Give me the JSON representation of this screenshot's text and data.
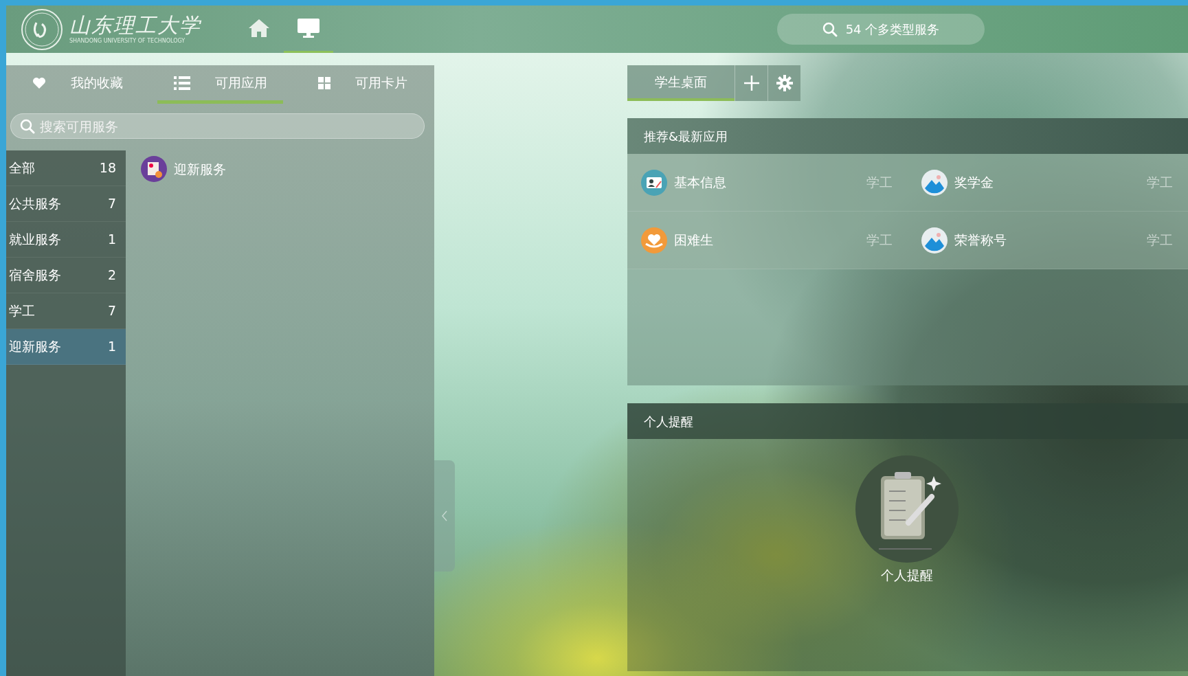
{
  "header": {
    "logo_title": "山东理工大学",
    "logo_subtitle": "SHANDONG UNIVERSITY OF TECHNOLOGY",
    "nav": [
      {
        "kind": "home",
        "selected": false
      },
      {
        "kind": "desktop",
        "selected": true
      }
    ],
    "search": {
      "label": "54 个多类型服务"
    }
  },
  "left_panel": {
    "tabs": [
      {
        "kind": "heart",
        "label": "我的收藏",
        "selected": false
      },
      {
        "kind": "list",
        "label": "可用应用",
        "selected": true
      },
      {
        "kind": "grid",
        "label": "可用卡片",
        "selected": false
      }
    ],
    "search": {
      "placeholder": "搜索可用服务"
    },
    "categories": [
      {
        "label": "全部",
        "count": "18",
        "selected": false
      },
      {
        "label": "公共服务",
        "count": "7",
        "selected": false
      },
      {
        "label": "就业服务",
        "count": "1",
        "selected": false
      },
      {
        "label": "宿舍服务",
        "count": "2",
        "selected": false
      },
      {
        "label": "学工",
        "count": "7",
        "selected": false
      },
      {
        "label": "迎新服务",
        "count": "1",
        "selected": true
      }
    ],
    "apps": [
      {
        "label": "迎新服务"
      }
    ]
  },
  "desktop_tabs": [
    {
      "label": "学生桌面",
      "selected": true
    }
  ],
  "recommended": {
    "title": "推荐&最新应用",
    "apps": [
      {
        "name": "基本信息",
        "tag": "学工",
        "kind": "profile"
      },
      {
        "name": "奖学金",
        "tag": "学工",
        "kind": "image"
      },
      {
        "name": "困难生",
        "tag": "学工",
        "kind": "hands"
      },
      {
        "name": "荣誉称号",
        "tag": "学工",
        "kind": "image"
      }
    ]
  },
  "reminder": {
    "title": "个人提醒",
    "empty_label": "个人提醒"
  }
}
